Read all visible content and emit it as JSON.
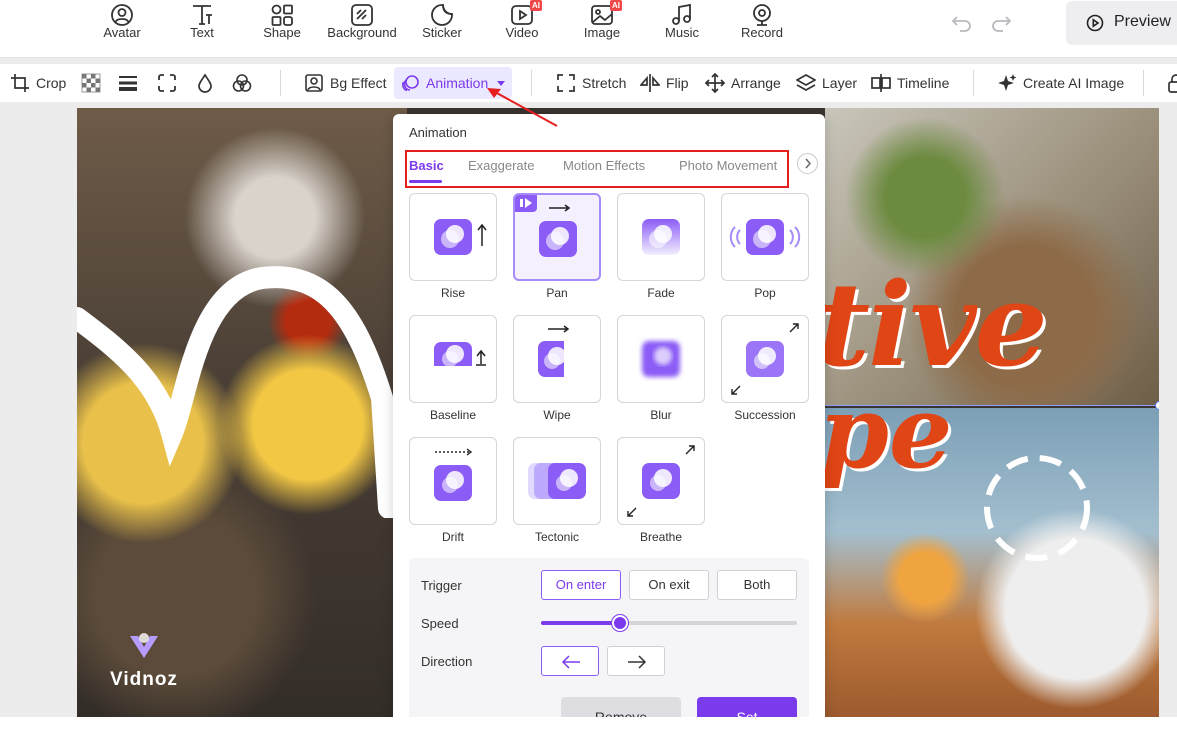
{
  "top_tools": [
    {
      "label": "Avatar",
      "icon": "avatar-icon"
    },
    {
      "label": "Text",
      "icon": "text-icon"
    },
    {
      "label": "Shape",
      "icon": "shape-icon"
    },
    {
      "label": "Background",
      "icon": "background-icon"
    },
    {
      "label": "Sticker",
      "icon": "sticker-icon"
    },
    {
      "label": "Video",
      "icon": "video-icon",
      "badge": "AI"
    },
    {
      "label": "Image",
      "icon": "image-icon",
      "badge": "AI"
    },
    {
      "label": "Music",
      "icon": "music-icon"
    },
    {
      "label": "Record",
      "icon": "record-icon"
    }
  ],
  "preview_label": "Preview",
  "toolbar2": {
    "crop": "Crop",
    "bg_effect": "Bg Effect",
    "animation": "Animation",
    "stretch": "Stretch",
    "flip": "Flip",
    "arrange": "Arrange",
    "layer": "Layer",
    "timeline": "Timeline",
    "create_ai_image": "Create AI Image"
  },
  "canvas": {
    "headline_1": "tive",
    "headline_2": "pe",
    "watermark": "Vidnoz"
  },
  "panel": {
    "title": "Animation",
    "tabs": [
      "Basic",
      "Exaggerate",
      "Motion Effects",
      "Photo Movement"
    ],
    "active_tab": "Basic",
    "animations": [
      "Rise",
      "Pan",
      "Fade",
      "Pop",
      "Baseline",
      "Wipe",
      "Blur",
      "Succession",
      "Drift",
      "Tectonic",
      "Breathe"
    ],
    "selected_animation": "Pan",
    "trigger_label": "Trigger",
    "trigger_options": [
      "On enter",
      "On exit",
      "Both"
    ],
    "trigger_selected": "On enter",
    "speed_label": "Speed",
    "speed_value": 0.31,
    "direction_label": "Direction",
    "direction_selected": "left",
    "remove_label": "Remove",
    "set_label": "Set"
  },
  "colors": {
    "accent": "#7c3aed",
    "highlight_box": "#e51e1e",
    "ai_badge": "#f04848"
  }
}
